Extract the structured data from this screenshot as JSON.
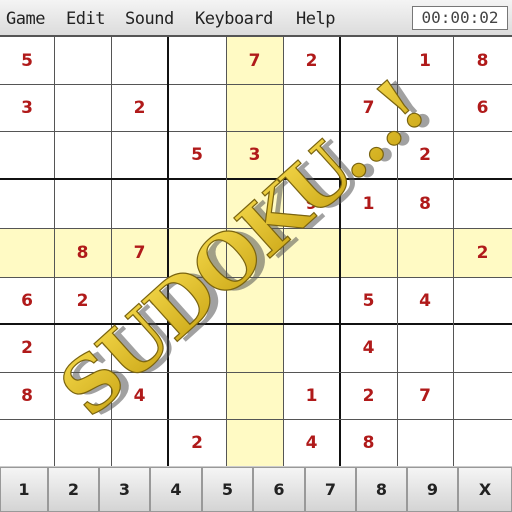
{
  "menu": [
    "Game",
    "Edit",
    "Sound",
    "Keyboard",
    "Help"
  ],
  "timer": "00:00:02",
  "highlight": {
    "row": 4,
    "col": 4,
    "color": "#fffac4"
  },
  "digit_color": "#b01a1a",
  "grid": [
    [
      "5",
      "",
      "",
      "",
      "7",
      "2",
      "",
      "1",
      "8"
    ],
    [
      "3",
      "",
      "2",
      "",
      "",
      "",
      "7",
      "",
      "6"
    ],
    [
      "",
      "",
      "",
      "5",
      "3",
      "",
      "",
      "2",
      ""
    ],
    [
      "",
      "",
      "",
      "",
      "",
      "9",
      "1",
      "8",
      ""
    ],
    [
      "",
      "8",
      "7",
      "",
      "",
      "",
      "",
      "",
      "2"
    ],
    [
      "6",
      "2",
      "",
      "",
      "",
      "",
      "5",
      "4",
      ""
    ],
    [
      "2",
      "",
      "",
      "",
      "",
      "",
      "4",
      "",
      ""
    ],
    [
      "8",
      "",
      "4",
      "",
      "",
      "1",
      "2",
      "7",
      ""
    ],
    [
      "",
      "",
      "",
      "2",
      "",
      "4",
      "8",
      "",
      ""
    ]
  ],
  "keypad": [
    "1",
    "2",
    "3",
    "4",
    "5",
    "6",
    "7",
    "8",
    "9",
    "X"
  ],
  "logo_text": "SUDOKU...!"
}
